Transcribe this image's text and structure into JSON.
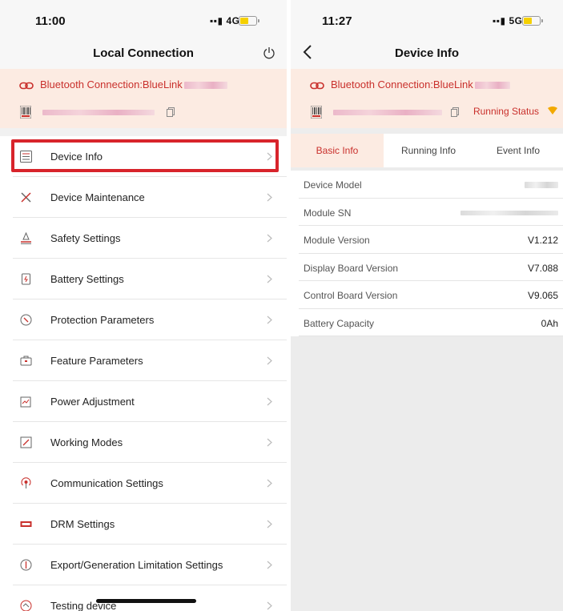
{
  "left": {
    "status": {
      "time": "11:00",
      "network": "4G"
    },
    "nav": {
      "title": "Local Connection"
    },
    "connection": {
      "label": "Bluetooth Connection:BlueLink"
    },
    "menu": [
      {
        "label": "Device Info",
        "icon": "list-icon"
      },
      {
        "label": "Device Maintenance",
        "icon": "tools-icon"
      },
      {
        "label": "Safety Settings",
        "icon": "safety-icon"
      },
      {
        "label": "Battery Settings",
        "icon": "battery-icon"
      },
      {
        "label": "Protection Parameters",
        "icon": "protection-icon"
      },
      {
        "label": "Feature Parameters",
        "icon": "briefcase-icon"
      },
      {
        "label": "Power Adjustment",
        "icon": "power-adjust-icon"
      },
      {
        "label": "Working Modes",
        "icon": "working-modes-icon"
      },
      {
        "label": "Communication Settings",
        "icon": "antenna-icon"
      },
      {
        "label": "DRM Settings",
        "icon": "drm-icon"
      },
      {
        "label": "Export/Generation Limitation Settings",
        "icon": "limit-icon"
      },
      {
        "label": "Testing device",
        "icon": "test-icon"
      }
    ]
  },
  "right": {
    "status": {
      "time": "11:27",
      "network": "5G"
    },
    "nav": {
      "title": "Device Info"
    },
    "connection": {
      "label": "Bluetooth Connection:BlueLink",
      "running_status": "Running Status"
    },
    "tabs": [
      {
        "label": "Basic Info",
        "active": true
      },
      {
        "label": "Running Info",
        "active": false
      },
      {
        "label": "Event Info",
        "active": false
      }
    ],
    "rows": [
      {
        "key": "Device Model",
        "value": ""
      },
      {
        "key": "Module SN",
        "value": ""
      },
      {
        "key": "Module Version",
        "value": "V1.212"
      },
      {
        "key": "Display Board Version",
        "value": "V7.088"
      },
      {
        "key": "Control Board Version",
        "value": "V9.065"
      },
      {
        "key": "Battery Capacity",
        "value": "0Ah"
      }
    ]
  },
  "colors": {
    "accent": "#c9302c",
    "highlight": "#d8242b",
    "banner": "#fcebe2",
    "battery_fill": "#f5d000"
  }
}
